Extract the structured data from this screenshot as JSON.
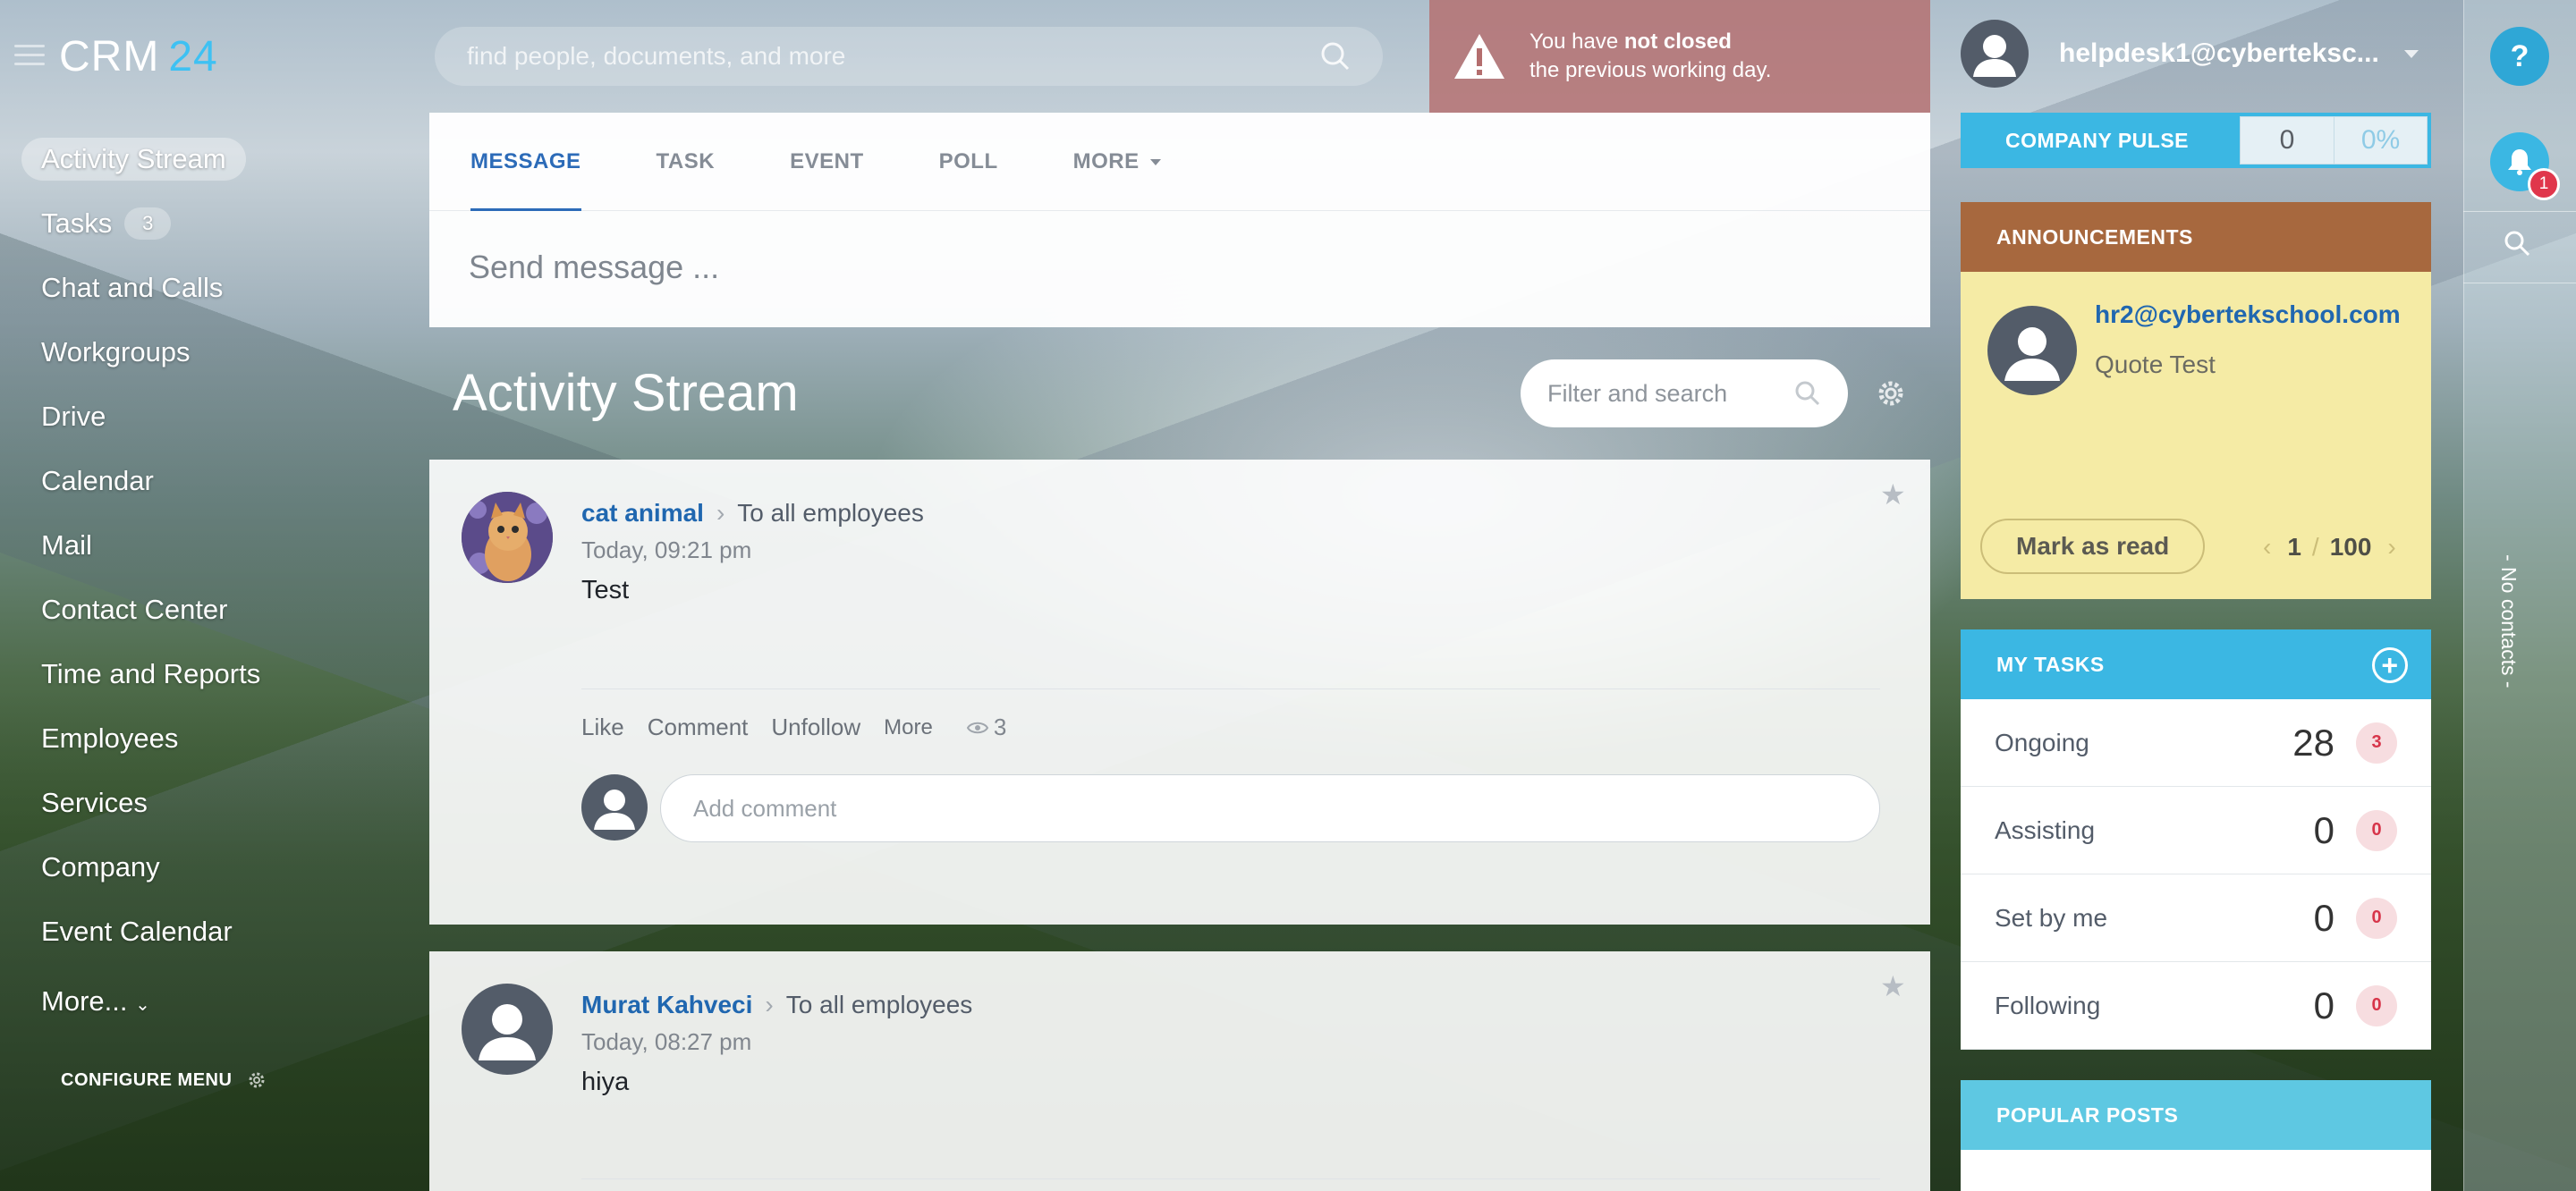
{
  "app": {
    "logo_main": "CRM",
    "logo_num": "24"
  },
  "sidebar": {
    "items": [
      {
        "label": "Activity Stream",
        "active": true
      },
      {
        "label": "Tasks",
        "badge": "3"
      },
      {
        "label": "Chat and Calls"
      },
      {
        "label": "Workgroups"
      },
      {
        "label": "Drive"
      },
      {
        "label": "Calendar"
      },
      {
        "label": "Mail"
      },
      {
        "label": "Contact Center"
      },
      {
        "label": "Time and Reports"
      },
      {
        "label": "Employees"
      },
      {
        "label": "Services"
      },
      {
        "label": "Company"
      },
      {
        "label": "Event Calendar"
      },
      {
        "label": "More..."
      }
    ],
    "configure_label": "CONFIGURE MENU"
  },
  "header": {
    "search_placeholder": "find people, documents, and more",
    "warning_pre": "You have ",
    "warning_bold": "not closed",
    "warning_line2": "the previous working day.",
    "user_name": "helpdesk1@cyberteksc..."
  },
  "edge": {
    "help": "?",
    "notifications": "1",
    "no_contacts": "- No contacts -"
  },
  "composer": {
    "tabs": [
      "MESSAGE",
      "TASK",
      "EVENT",
      "POLL",
      "MORE"
    ],
    "placeholder": "Send message ..."
  },
  "stream": {
    "title": "Activity Stream",
    "filter_placeholder": "Filter and search"
  },
  "posts": [
    {
      "author": "cat animal",
      "destination": "To all employees",
      "time": "Today, 09:21 pm",
      "text": "Test",
      "actions": [
        "Like",
        "Comment",
        "Unfollow",
        "More"
      ],
      "views": "3",
      "comment_placeholder": "Add comment"
    },
    {
      "author": "Murat Kahveci",
      "destination": "To all employees",
      "time": "Today, 08:27 pm",
      "text": "hiya"
    }
  ],
  "pulse": {
    "label": "COMPANY PULSE",
    "value": "0",
    "percent": "0%"
  },
  "announcements": {
    "title": "ANNOUNCEMENTS",
    "email": "hr2@cybertekschool.com",
    "text": "Quote Test",
    "mark_label": "Mark as read",
    "page": "1",
    "total": "100"
  },
  "tasks": {
    "title": "MY TASKS",
    "rows": [
      {
        "label": "Ongoing",
        "value": "28",
        "count": "3"
      },
      {
        "label": "Assisting",
        "value": "0",
        "count": "0"
      },
      {
        "label": "Set by me",
        "value": "0",
        "count": "0"
      },
      {
        "label": "Following",
        "value": "0",
        "count": "0"
      }
    ]
  },
  "popular": {
    "title": "POPULAR POSTS"
  },
  "colors": {
    "accent": "#3bb7e3",
    "link": "#2067b0",
    "announce_header": "#a7683e",
    "warning_bg": "#b46e6e"
  }
}
